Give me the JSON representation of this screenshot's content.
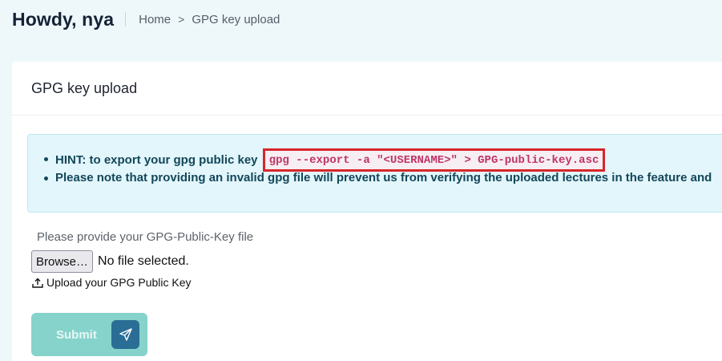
{
  "header": {
    "greeting": "Howdy, nya",
    "breadcrumb": {
      "home": "Home",
      "separator": ">",
      "current": "GPG key upload"
    }
  },
  "card": {
    "title": "GPG key upload",
    "hints": {
      "item1_text": "HINT: to export your gpg public key",
      "item1_code": "gpg --export -a \"<USERNAME>\" > GPG-public-key.asc",
      "item2_text": "Please note that providing an invalid gpg file will prevent us from verifying the uploaded lectures in the feature and"
    },
    "file_field": {
      "label": "Please provide your GPG-Public-Key file",
      "browse_label": "Browse…",
      "status": "No file selected.",
      "helper": "Upload your GPG Public Key"
    },
    "submit_label": "Submit"
  },
  "colors": {
    "page_bg": "#eef8fb",
    "hint_bg": "#e3f6fb",
    "code_highlight_border": "#d7262b",
    "code_text": "#c0346a",
    "submit_bg": "#86d3cb",
    "submit_icon_bg": "#2b6e95"
  },
  "icons": {
    "upload": "upload-icon",
    "send": "send-icon",
    "chevron": "chevron-right-icon"
  }
}
